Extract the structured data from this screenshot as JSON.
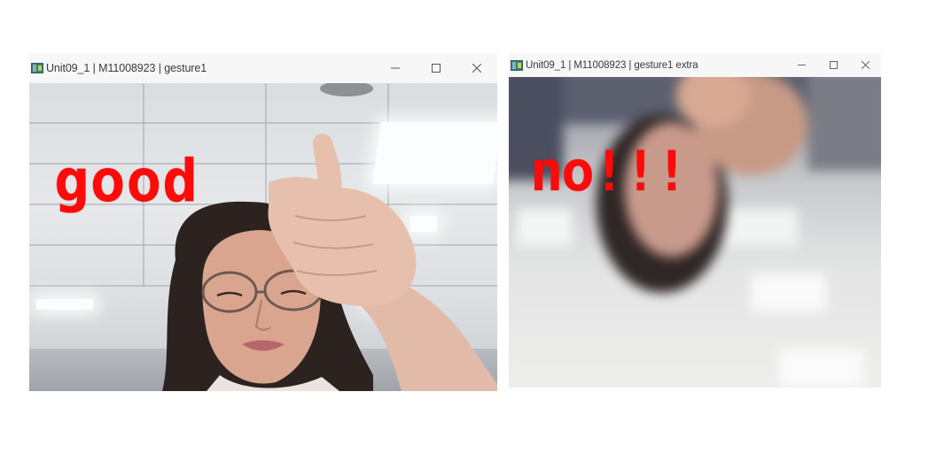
{
  "windows": [
    {
      "title": "Unit09_1 | M11008923 | gesture1",
      "overlay_text": "good"
    },
    {
      "title": "Unit09_1 | M11008923 | gesture1 extra",
      "overlay_text": "no!!!"
    }
  ],
  "icons": {
    "app": "opencv-window-icon",
    "minimize": "minimize-icon",
    "maximize": "maximize-icon",
    "close": "close-icon"
  },
  "colors": {
    "overlay_text": "#ff0a0a",
    "titlebar": "#f7f7f7"
  }
}
